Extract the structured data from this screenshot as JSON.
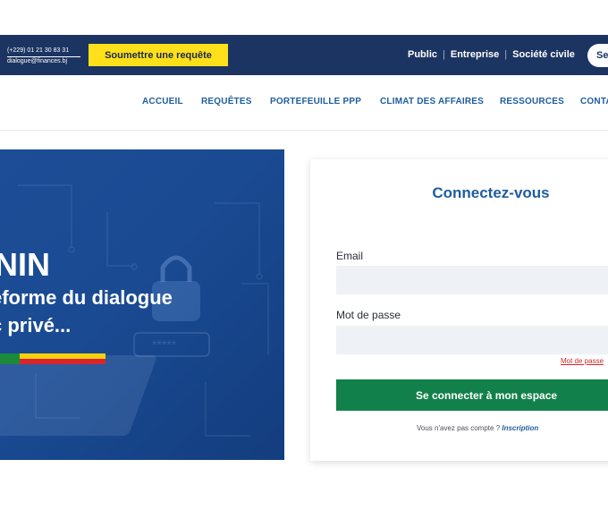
{
  "topbar": {
    "phone": "(+229) 01 21 30 83 31",
    "email": "dialogue@finances.bj",
    "request_button": "Soumettre une requête",
    "audiences": [
      "Public",
      "Entreprise",
      "Société civile"
    ],
    "pill_label": "Se"
  },
  "nav": {
    "items": [
      "ACCUEIL",
      "REQUÊTES",
      "PORTEFEUILLE PPP",
      "CLIMAT DES AFFAIRES",
      "RESSOURCES",
      "CONTA"
    ]
  },
  "hero": {
    "title": "NIN",
    "line1": "eforme du dialogue",
    "line2": "c privé...",
    "flag_colors": {
      "green": "#1b8a3c",
      "yellow": "#f5d20c",
      "red": "#d8262c"
    },
    "password_mask": "*****"
  },
  "login": {
    "title": "Connectez-vous",
    "email_label": "Email",
    "email_value": "",
    "password_label": "Mot de passe",
    "password_value": "",
    "forgot_link": "Mot de passe",
    "submit_label": "Se connecter à mon espace",
    "no_account_text": "Vous n'avez pas compte ?",
    "signup_link": "Inscription"
  },
  "colors": {
    "topbar": "#1c3461",
    "accent_yellow": "#ffe01a",
    "nav_blue": "#1e5d9c",
    "submit_green": "#12804a",
    "link_red": "#d02a2a"
  }
}
